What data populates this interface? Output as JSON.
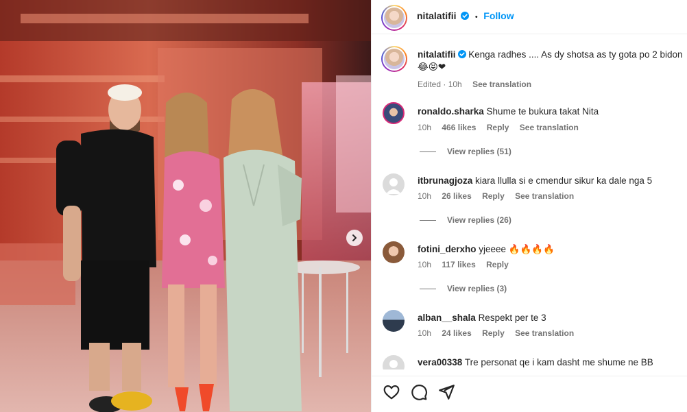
{
  "post": {
    "username": "nitalatifii",
    "follow_label": "Follow",
    "separator": "•"
  },
  "caption": {
    "username": "nitalatifii",
    "text": "Kenga radhes .... As dy shotsa as ty gota po 2 bidon",
    "emojis": "😂😝❤",
    "edited": "Edited · 10h",
    "see_translation": "See translation"
  },
  "comments": [
    {
      "username": "ronaldo.sharka",
      "text": "Shume te bukura takat Nita",
      "time": "10h",
      "likes": "466 likes",
      "reply": "Reply",
      "see_translation": "See translation",
      "view_replies": "View replies (51)"
    },
    {
      "username": "itbrunagjoza",
      "text": "kiara llulla si e cmendur sikur ka dale nga 5",
      "time": "10h",
      "likes": "26 likes",
      "reply": "Reply",
      "see_translation": "See translation",
      "view_replies": "View replies (26)"
    },
    {
      "username": "fotini_derxho",
      "text": "yjeeee 🔥🔥🔥🔥",
      "time": "10h",
      "likes": "117 likes",
      "reply": "Reply",
      "view_replies": "View replies (3)"
    },
    {
      "username": "alban__shala",
      "text": "Respekt per te 3",
      "time": "10h",
      "likes": "24 likes",
      "reply": "Reply",
      "see_translation": "See translation"
    },
    {
      "username": "vera00338",
      "text": "Tre personat qe i kam dasht me shume ne BB"
    }
  ],
  "icons": {
    "like": "heart-icon",
    "comment": "comment-icon",
    "share": "share-icon",
    "verified": "verified-badge-icon",
    "next": "chevron-right-icon"
  },
  "colors": {
    "link": "#0095f6",
    "meta": "#737373",
    "text": "#262626"
  }
}
